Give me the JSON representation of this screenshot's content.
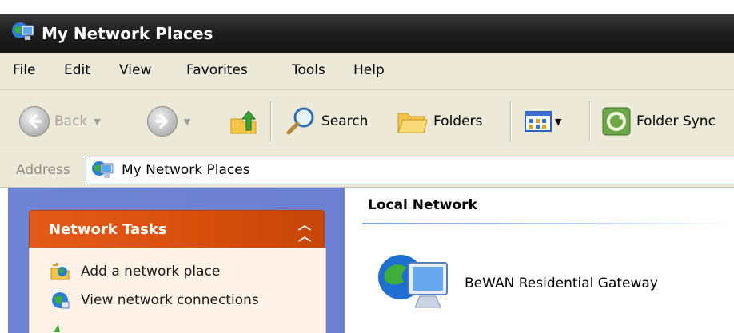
{
  "window": {
    "title": "My Network Places",
    "icon": "network-places-icon"
  },
  "menu": [
    "File",
    "Edit",
    "View",
    "Favorites",
    "Tools",
    "Help"
  ],
  "toolbar": {
    "back_label": "Back",
    "forward_icon": "forward-arrow-icon",
    "up_icon": "up-folder-icon",
    "search_label": "Search",
    "folders_label": "Folders",
    "views_icon": "views-icon",
    "foldersync_label": "Folder Sync"
  },
  "address": {
    "label": "Address",
    "value": "My Network Places"
  },
  "tasks_panel": {
    "title": "Network Tasks",
    "items": [
      {
        "label": "Add a network place",
        "icon": "add-network-place-icon"
      },
      {
        "label": "View network connections",
        "icon": "view-connections-icon"
      }
    ]
  },
  "content": {
    "group_title": "Local Network",
    "items": [
      {
        "label": "BeWAN Residential Gateway",
        "icon": "network-device-icon"
      }
    ]
  },
  "colors": {
    "title_bar": "#1f1f1f",
    "panel_header": "#d64f0b",
    "left_pane": "#6c7fd0",
    "chrome": "#ece9d8"
  }
}
